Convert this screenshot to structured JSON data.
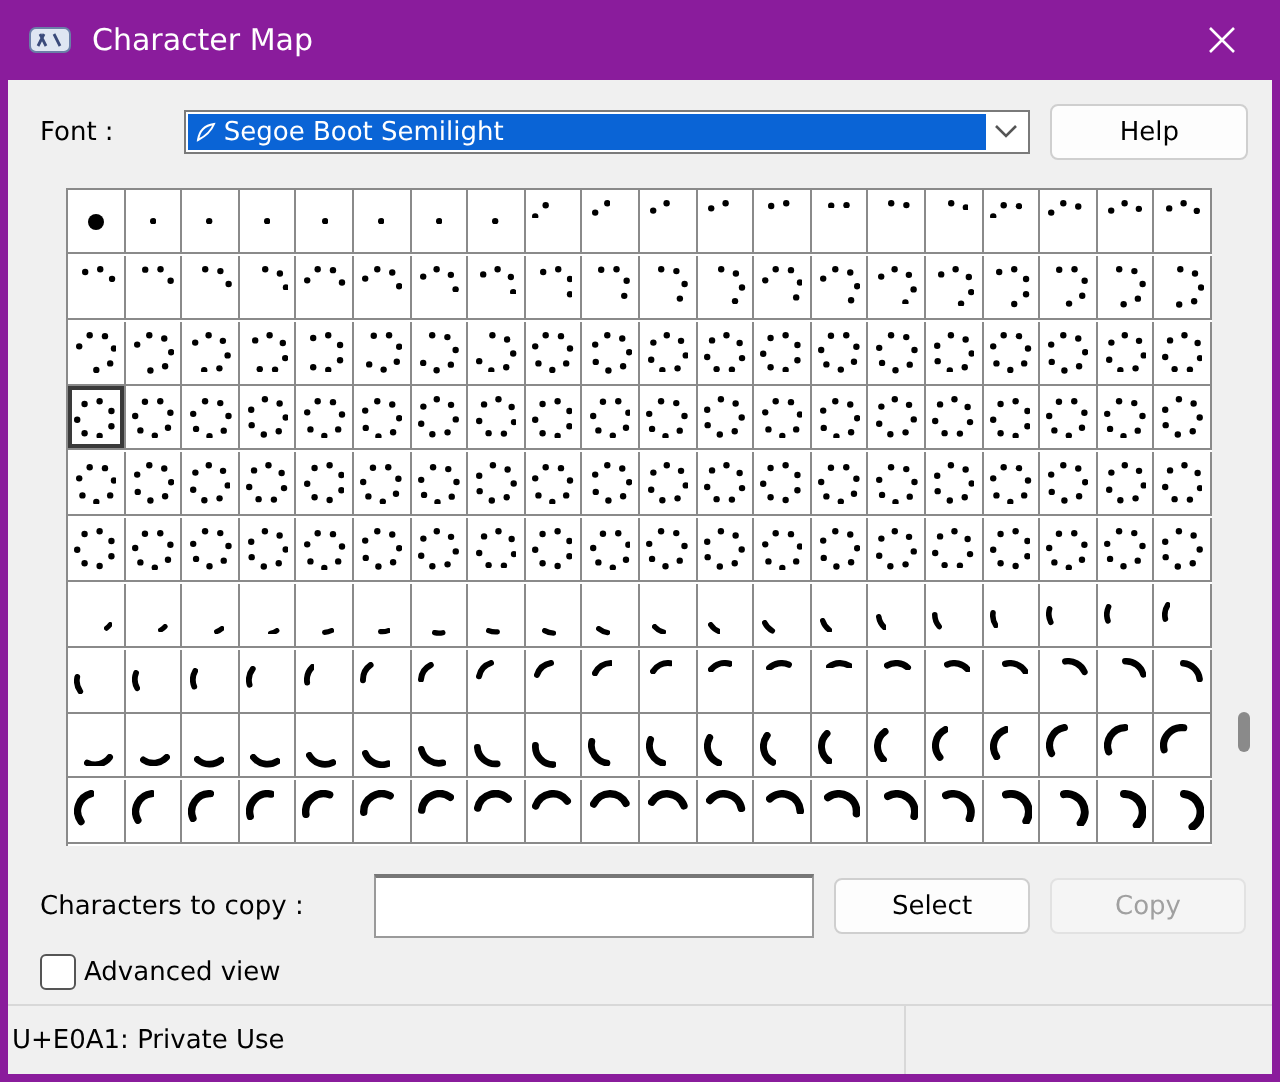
{
  "window": {
    "title": "Character Map"
  },
  "font": {
    "label": "Font :",
    "value": "Segoe Boot Semilight"
  },
  "help_button": {
    "label": "Help"
  },
  "grid": {
    "rows": [
      {
        "cells": [
          {
            "selected": false
          },
          {
            "selected": false
          },
          {
            "selected": false
          },
          {
            "selected": false
          },
          {
            "selected": false
          },
          {
            "selected": false
          },
          {
            "selected": false
          },
          {
            "selected": false
          },
          {
            "selected": false
          },
          {
            "selected": false
          },
          {
            "selected": false
          },
          {
            "selected": false
          },
          {
            "selected": false
          },
          {
            "selected": false
          },
          {
            "selected": false
          },
          {
            "selected": false
          },
          {
            "selected": false
          },
          {
            "selected": false
          },
          {
            "selected": false
          },
          {
            "selected": false
          }
        ]
      },
      {
        "cells": [
          {
            "selected": false
          },
          {
            "selected": false
          },
          {
            "selected": false
          },
          {
            "selected": false
          },
          {
            "selected": false
          },
          {
            "selected": false
          },
          {
            "selected": false
          },
          {
            "selected": false
          },
          {
            "selected": false
          },
          {
            "selected": false
          },
          {
            "selected": false
          },
          {
            "selected": false
          },
          {
            "selected": false
          },
          {
            "selected": false
          },
          {
            "selected": false
          },
          {
            "selected": false
          },
          {
            "selected": false
          },
          {
            "selected": false
          },
          {
            "selected": false
          },
          {
            "selected": false
          }
        ]
      },
      {
        "cells": [
          {
            "selected": false
          },
          {
            "selected": false
          },
          {
            "selected": false
          },
          {
            "selected": false
          },
          {
            "selected": false
          },
          {
            "selected": false
          },
          {
            "selected": false
          },
          {
            "selected": false
          },
          {
            "selected": false
          },
          {
            "selected": false
          },
          {
            "selected": false
          },
          {
            "selected": false
          },
          {
            "selected": false
          },
          {
            "selected": false
          },
          {
            "selected": false
          },
          {
            "selected": false
          },
          {
            "selected": false
          },
          {
            "selected": false
          },
          {
            "selected": false
          },
          {
            "selected": false
          }
        ]
      },
      {
        "cells": [
          {
            "selected": true
          },
          {
            "selected": false
          },
          {
            "selected": false
          },
          {
            "selected": false
          },
          {
            "selected": false
          },
          {
            "selected": false
          },
          {
            "selected": false
          },
          {
            "selected": false
          },
          {
            "selected": false
          },
          {
            "selected": false
          },
          {
            "selected": false
          },
          {
            "selected": false
          },
          {
            "selected": false
          },
          {
            "selected": false
          },
          {
            "selected": false
          },
          {
            "selected": false
          },
          {
            "selected": false
          },
          {
            "selected": false
          },
          {
            "selected": false
          },
          {
            "selected": false
          }
        ]
      },
      {
        "cells": [
          {
            "selected": false
          },
          {
            "selected": false
          },
          {
            "selected": false
          },
          {
            "selected": false
          },
          {
            "selected": false
          },
          {
            "selected": false
          },
          {
            "selected": false
          },
          {
            "selected": false
          },
          {
            "selected": false
          },
          {
            "selected": false
          },
          {
            "selected": false
          },
          {
            "selected": false
          },
          {
            "selected": false
          },
          {
            "selected": false
          },
          {
            "selected": false
          },
          {
            "selected": false
          },
          {
            "selected": false
          },
          {
            "selected": false
          },
          {
            "selected": false
          },
          {
            "selected": false
          }
        ]
      },
      {
        "cells": [
          {
            "selected": false
          },
          {
            "selected": false
          },
          {
            "selected": false
          },
          {
            "selected": false
          },
          {
            "selected": false
          },
          {
            "selected": false
          },
          {
            "selected": false
          },
          {
            "selected": false
          },
          {
            "selected": false
          },
          {
            "selected": false
          },
          {
            "selected": false
          },
          {
            "selected": false
          },
          {
            "selected": false
          },
          {
            "selected": false
          },
          {
            "selected": false
          },
          {
            "selected": false
          },
          {
            "selected": false
          },
          {
            "selected": false
          },
          {
            "selected": false
          },
          {
            "selected": false
          }
        ]
      },
      {
        "cells": [
          {
            "selected": false
          },
          {
            "selected": false
          },
          {
            "selected": false
          },
          {
            "selected": false
          },
          {
            "selected": false
          },
          {
            "selected": false
          },
          {
            "selected": false
          },
          {
            "selected": false
          },
          {
            "selected": false
          },
          {
            "selected": false
          },
          {
            "selected": false
          },
          {
            "selected": false
          },
          {
            "selected": false
          },
          {
            "selected": false
          },
          {
            "selected": false
          },
          {
            "selected": false
          },
          {
            "selected": false
          },
          {
            "selected": false
          },
          {
            "selected": false
          },
          {
            "selected": false
          }
        ]
      },
      {
        "cells": [
          {
            "selected": false
          },
          {
            "selected": false
          },
          {
            "selected": false
          },
          {
            "selected": false
          },
          {
            "selected": false
          },
          {
            "selected": false
          },
          {
            "selected": false
          },
          {
            "selected": false
          },
          {
            "selected": false
          },
          {
            "selected": false
          },
          {
            "selected": false
          },
          {
            "selected": false
          },
          {
            "selected": false
          },
          {
            "selected": false
          },
          {
            "selected": false
          },
          {
            "selected": false
          },
          {
            "selected": false
          },
          {
            "selected": false
          },
          {
            "selected": false
          },
          {
            "selected": false
          }
        ]
      },
      {
        "cells": [
          {
            "selected": false
          },
          {
            "selected": false
          },
          {
            "selected": false
          },
          {
            "selected": false
          },
          {
            "selected": false
          },
          {
            "selected": false
          },
          {
            "selected": false
          },
          {
            "selected": false
          },
          {
            "selected": false
          },
          {
            "selected": false
          },
          {
            "selected": false
          },
          {
            "selected": false
          },
          {
            "selected": false
          },
          {
            "selected": false
          },
          {
            "selected": false
          },
          {
            "selected": false
          },
          {
            "selected": false
          },
          {
            "selected": false
          },
          {
            "selected": false
          },
          {
            "selected": false
          }
        ]
      },
      {
        "cells": [
          {
            "selected": false
          },
          {
            "selected": false
          },
          {
            "selected": false
          },
          {
            "selected": false
          },
          {
            "selected": false
          },
          {
            "selected": false
          },
          {
            "selected": false
          },
          {
            "selected": false
          },
          {
            "selected": false
          },
          {
            "selected": false
          },
          {
            "selected": false
          },
          {
            "selected": false
          },
          {
            "selected": false
          },
          {
            "selected": false
          },
          {
            "selected": false
          },
          {
            "selected": false
          },
          {
            "selected": false
          },
          {
            "selected": false
          },
          {
            "selected": false
          },
          {
            "selected": false
          }
        ]
      }
    ]
  },
  "copy": {
    "label": "Characters to copy :"
  },
  "buttons": [
    {
      "label": "Select",
      "disabled": false
    },
    {
      "label": "Copy",
      "disabled": true
    }
  ],
  "advanced_view": {
    "label": "Advanced view",
    "checked": false
  },
  "status_bar": {
    "text": "U+E0A1: Private Use"
  }
}
